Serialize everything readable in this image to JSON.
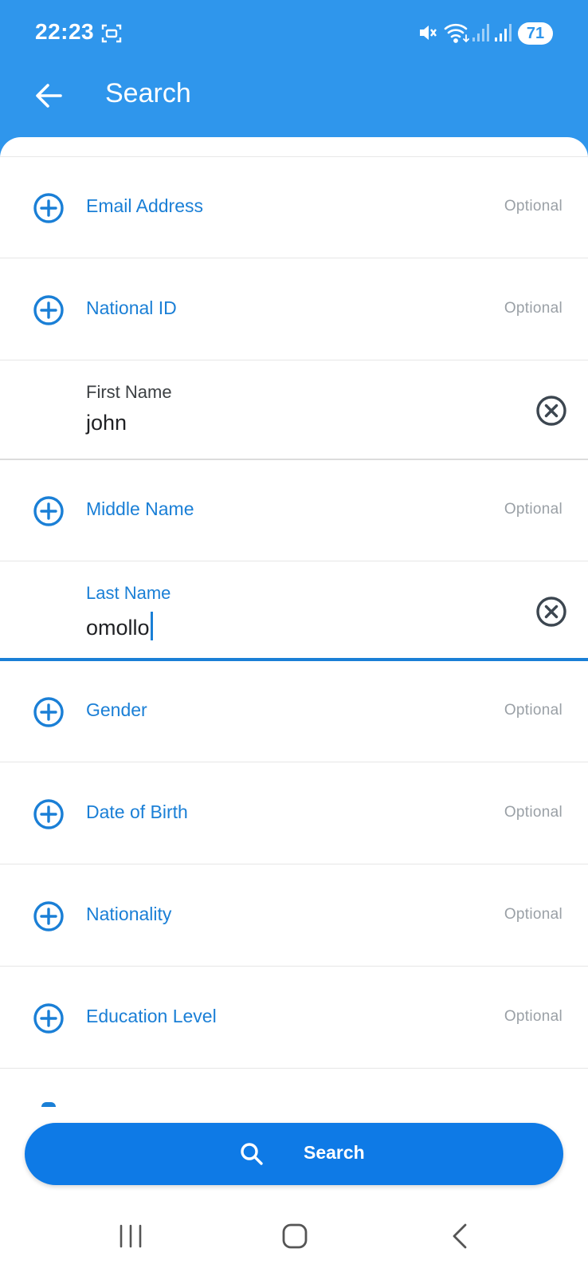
{
  "status": {
    "time": "22:23",
    "battery": "71",
    "icons": [
      "screenshot-icon",
      "mute-icon",
      "wifi-icon",
      "signal-icon",
      "signal-icon"
    ]
  },
  "appbar": {
    "title": "Search",
    "back_icon": "arrow-left-icon"
  },
  "fields": [
    {
      "label": "Email Address",
      "hint": "Optional",
      "state": "collapsed"
    },
    {
      "label": "National ID",
      "hint": "Optional",
      "state": "collapsed"
    },
    {
      "label": "First Name",
      "value": "john",
      "state": "filled"
    },
    {
      "label": "Middle Name",
      "hint": "Optional",
      "state": "collapsed"
    },
    {
      "label": "Last Name",
      "value": "omollo",
      "state": "focused"
    },
    {
      "label": "Gender",
      "hint": "Optional",
      "state": "collapsed"
    },
    {
      "label": "Date of Birth",
      "hint": "Optional",
      "state": "collapsed"
    },
    {
      "label": "Nationality",
      "hint": "Optional",
      "state": "collapsed"
    },
    {
      "label": "Education Level",
      "hint": "Optional",
      "state": "collapsed"
    }
  ],
  "search_button": {
    "label": "Search",
    "icon": "search-icon"
  },
  "colors": {
    "header": "#2f96ec",
    "accent": "#1a7fd6",
    "button": "#0e7ae6",
    "hint": "#9aa0a6"
  }
}
